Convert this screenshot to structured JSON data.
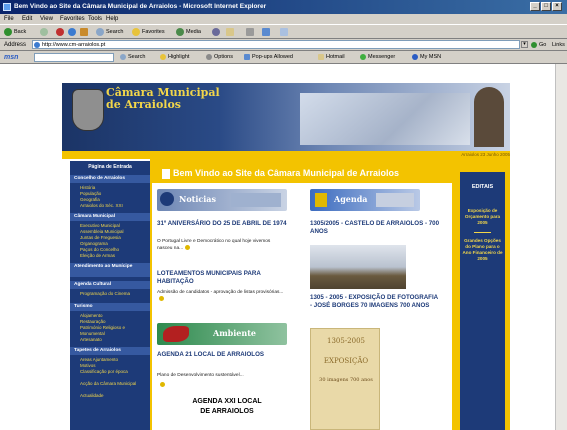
{
  "window": {
    "title": "Bem Vindo ao Site da Câmara Municipal de Arraiolos - Microsoft Internet Explorer"
  },
  "menu": [
    "File",
    "Edit",
    "View",
    "Favorites",
    "Tools",
    "Help"
  ],
  "toolbar": {
    "back": "Back",
    "search": "Search",
    "favorites": "Favorites",
    "media": "Media"
  },
  "address": {
    "label": "Address",
    "url": "http://www.cm-arraiolos.pt",
    "go": "Go",
    "links": "Links"
  },
  "linksbar": {
    "msn": "msn",
    "search": "Search",
    "highlight": "Highlight",
    "options": "Options",
    "popups": "Pop-ups Allowed",
    "hotmail": "Hotmail",
    "messenger": "Messenger",
    "mymsn": "My MSN"
  },
  "banner": {
    "line1": "Câmara Municipal",
    "line2": "de Arraiolos"
  },
  "page": {
    "welcome": "Bem Vindo ao Site da Câmara Municipal de Arraiolos",
    "date": "Arraiolos 23 Junho 2005"
  },
  "leftnav": {
    "top": "Página de Entrada",
    "sections": [
      {
        "heading": "Concelho de Arraiolos",
        "items": [
          "História",
          "População",
          "Geografia",
          "Arraiolos do Séc. XXI"
        ]
      },
      {
        "heading": "Câmara Municipal",
        "items": [
          "Executivo Municipal",
          "Assembleia Municipal",
          "Juntas de Freguesia",
          "Organograma",
          "Paços do Concelho",
          "Eleição de Armas"
        ]
      },
      {
        "heading": "Atendimento ao Munícipe",
        "items": []
      },
      {
        "heading": "Agenda Cultural",
        "items": [
          "Programação do Cinema"
        ]
      },
      {
        "heading": "Turismo",
        "items": [
          "Alojamento",
          "Restauração",
          "Património Religioso e Monumental",
          "Artesanato"
        ]
      },
      {
        "heading": "Tapetes de Arraiolos",
        "items": [
          "Areas Ajuntamento",
          "Motivos",
          "Classificação por época",
          "Acção da Câmara Municipal",
          "Actualidade"
        ]
      }
    ]
  },
  "sections": {
    "noticias": {
      "label": "Noticias",
      "items": [
        {
          "title": "31º ANIVERSÁRIO DO 25 DE ABRIL DE 1974",
          "body": "O Portugal Livre e Democrático no qual hoje vivemos nasceu na..."
        },
        {
          "title": "LOTEAMENTOS MUNICIPAIS PARA HABITAÇÃO",
          "body": "Admissão de candidatos - aprovação de listas provisórias..."
        }
      ]
    },
    "agenda": {
      "label": "Agenda",
      "items": [
        {
          "title": "1305/2005 - CASTELO DE ARRAIOLOS - 700 ANOS"
        },
        {
          "title": "1305 - 2005 - EXPOSIÇÃO DE FOTOGRAFIA - JOSÉ BORGES 70 IMAGENS 700 ANOS"
        }
      ],
      "poster": {
        "line1": "1305-2005",
        "line2": "EXPOSIÇÃO",
        "line3": "30 imagens 700 anos"
      }
    },
    "ambiente": {
      "label": "Ambiente",
      "items": [
        {
          "title": "AGENDA 21 LOCAL DE ARRAIOLOS",
          "body": "Plano de Desenvolvimento sustentável..."
        }
      ],
      "logo": {
        "line1": "AGENDA XXI LOCAL",
        "line2": "DE ARRAIOLOS"
      }
    }
  },
  "editais": {
    "heading": "EDITAIS",
    "items": [
      "Exposição de Orçamento para 2005",
      "Grandes Opções do Plano para o Ano Financeiro de 2005"
    ]
  },
  "colors": {
    "navy": "#1d3a78",
    "yellow": "#f3c300",
    "gold": "#f2d64a"
  }
}
